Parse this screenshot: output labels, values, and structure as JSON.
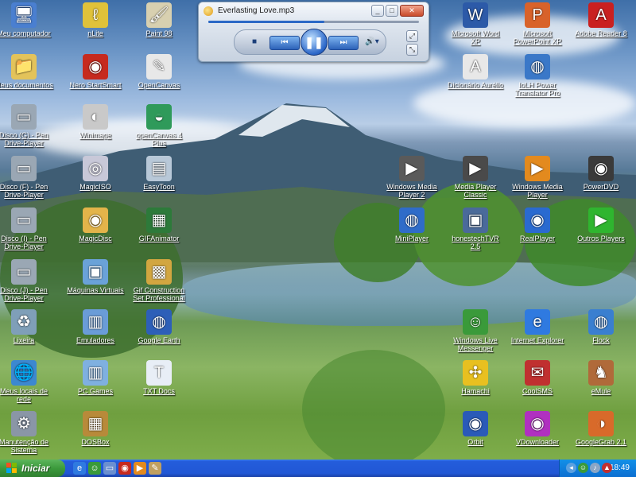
{
  "desktop_icons": [
    {
      "label": "Meu computador",
      "icon": "computer-icon",
      "color": "#4a7fd0",
      "glyph": "🖥"
    },
    {
      "label": "nLite",
      "icon": "nlite-icon",
      "color": "#e0c23a",
      "glyph": "ℓ"
    },
    {
      "label": "Paint 98",
      "icon": "paint-icon",
      "color": "#d8d0b0",
      "glyph": "🖌"
    },
    {
      "label": "Meus documentos",
      "icon": "folder-icon",
      "color": "#e3c35a",
      "glyph": "📁"
    },
    {
      "label": "Nero StartSmart",
      "icon": "nero-icon",
      "color": "#c62a1e",
      "glyph": "◉"
    },
    {
      "label": "OpenCanvas",
      "icon": "opencanvas-icon",
      "color": "#e8e8e8",
      "glyph": "✎"
    },
    {
      "label": "Disco (G) - Pen Drive-Player",
      "icon": "usb-drive-icon",
      "color": "#9aa7b4",
      "glyph": "▭"
    },
    {
      "label": "Winimage",
      "icon": "winimage-icon",
      "color": "#c9c9c9",
      "glyph": "◐"
    },
    {
      "label": "openCanvas 4 Plus",
      "icon": "opencanvas-plus-icon",
      "color": "#2f9a5a",
      "glyph": "◒"
    },
    {
      "label": "Disco (F) - Pen Drive-Player",
      "icon": "usb-drive-icon",
      "color": "#9aa7b4",
      "glyph": "▭"
    },
    {
      "label": "MagicISO",
      "icon": "magiciso-icon",
      "color": "#c8c8d8",
      "glyph": "◎"
    },
    {
      "label": "EasyToon",
      "icon": "easytoon-icon",
      "color": "#b8c8d8",
      "glyph": "▤"
    },
    {
      "label": "Disco (I) - Pen Drive-Player",
      "icon": "usb-drive-icon",
      "color": "#9aa7b4",
      "glyph": "▭"
    },
    {
      "label": "MagicDisc",
      "icon": "magicdisc-icon",
      "color": "#e3b44a",
      "glyph": "◉"
    },
    {
      "label": "GIFAnimator",
      "icon": "gifanimator-icon",
      "color": "#2d7a3a",
      "glyph": "▦"
    },
    {
      "label": "Disco (J) - Pen Drive-Player",
      "icon": "usb-drive-icon",
      "color": "#9aa7b4",
      "glyph": "▭"
    },
    {
      "label": "Máquinas Virtuais",
      "icon": "virtual-machine-icon",
      "color": "#6aa2d8",
      "glyph": "▣"
    },
    {
      "label": "Gif Construction Set Professional",
      "icon": "gif-construction-icon",
      "color": "#d2a640",
      "glyph": "▩"
    },
    {
      "label": "Lixeira",
      "icon": "recycle-bin-icon",
      "color": "#7f9fb8",
      "glyph": "♻"
    },
    {
      "label": "Emuladores",
      "icon": "folder-icon",
      "color": "#6a9cd8",
      "glyph": "▥"
    },
    {
      "label": "Google Earth",
      "icon": "google-earth-icon",
      "color": "#2d5fb8",
      "glyph": "◍"
    },
    {
      "label": "Meus locais de rede",
      "icon": "network-icon",
      "color": "#3c88d0",
      "glyph": "🌐"
    },
    {
      "label": "PC Games",
      "icon": "folder-icon",
      "color": "#7fb0e0",
      "glyph": "▥"
    },
    {
      "label": "TXT Docs",
      "icon": "text-document-icon",
      "color": "#e8eef6",
      "glyph": "T"
    },
    {
      "label": "Manutenção de Sistema",
      "icon": "gear-icon",
      "color": "#8a96a6",
      "glyph": "⚙"
    },
    {
      "label": "DOSBox",
      "icon": "dosbox-icon",
      "color": "#b88a3a",
      "glyph": "▦"
    },
    {
      "label": "Microsoft Word XP",
      "icon": "word-icon",
      "color": "#2c5aa8",
      "glyph": "W"
    },
    {
      "label": "Microsoft PowerPoint XP",
      "icon": "powerpoint-icon",
      "color": "#d8622a",
      "glyph": "P"
    },
    {
      "label": "Adobe Reader 8",
      "icon": "adobe-reader-icon",
      "color": "#c92020",
      "glyph": "A"
    },
    {
      "label": "Dicionário Aurélio",
      "icon": "dictionary-icon",
      "color": "#e8e8e8",
      "glyph": "A"
    },
    {
      "label": "IoLH Power Translator Pro",
      "icon": "globe-icon",
      "color": "#3a78c8",
      "glyph": "◍"
    },
    {
      "label": "Windows Media Player 2",
      "icon": "media-player-icon",
      "color": "#5a5a5a",
      "glyph": "▶"
    },
    {
      "label": "Media Player Classic",
      "icon": "media-player-classic-icon",
      "color": "#4a4a4a",
      "glyph": "▶"
    },
    {
      "label": "Windows Media Player",
      "icon": "windows-media-player-icon",
      "color": "#e38a1e",
      "glyph": "▶"
    },
    {
      "label": "PowerDVD",
      "icon": "powerdvd-icon",
      "color": "#3a3a3a",
      "glyph": "◉"
    },
    {
      "label": "MiniPlayer",
      "icon": "miniplayer-icon",
      "color": "#2f6cc9",
      "glyph": "◍"
    },
    {
      "label": "honestechTVR 2.5",
      "icon": "tv-icon",
      "color": "#4a6a9a",
      "glyph": "▣"
    },
    {
      "label": "RealPlayer",
      "icon": "realplayer-icon",
      "color": "#2a6ad0",
      "glyph": "◉"
    },
    {
      "label": "Outros Players",
      "icon": "play-arrow-icon",
      "color": "#2fb52f",
      "glyph": "▶"
    },
    {
      "label": "Windows Live Messenger",
      "icon": "messenger-icon",
      "color": "#3a9a3a",
      "glyph": "☺"
    },
    {
      "label": "Internet Explorer",
      "icon": "internet-explorer-icon",
      "color": "#2f7ae0",
      "glyph": "e"
    },
    {
      "label": "Flock",
      "icon": "flock-icon",
      "color": "#3a7fd0",
      "glyph": "◍"
    },
    {
      "label": "Hamachi",
      "icon": "hamachi-icon",
      "color": "#e8c020",
      "glyph": "✣"
    },
    {
      "label": "CoolSMS",
      "icon": "coolsms-icon",
      "color": "#c03030",
      "glyph": "✉"
    },
    {
      "label": "eMule",
      "icon": "emule-icon",
      "color": "#b06a3a",
      "glyph": "♞"
    },
    {
      "label": "Orbit",
      "icon": "orbit-icon",
      "color": "#2a5ab8",
      "glyph": "◉"
    },
    {
      "label": "VDownloader",
      "icon": "vdownloader-icon",
      "color": "#b030c0",
      "glyph": "◉"
    },
    {
      "label": "GoogleGrab 2.1",
      "icon": "googlegrab-icon",
      "color": "#d86a2a",
      "glyph": "◑"
    }
  ],
  "player": {
    "title": "Everlasting Love.mp3",
    "progress_fraction": 0.55,
    "stop_glyph": "■",
    "prev_glyph": "⏮",
    "play_pause_glyph": "❚❚",
    "next_glyph": "⏭",
    "volume_glyph": "🔊▾",
    "minimize_glyph": "_",
    "maximize_glyph": "□",
    "close_glyph": "✕",
    "restore_glyph": "⤢",
    "compact_glyph": "⤡"
  },
  "taskbar": {
    "start_label": "Iniciar",
    "clock": "18:49",
    "quicklaunch": [
      {
        "icon": "internet-explorer-icon",
        "color": "#2f7ae0",
        "glyph": "e"
      },
      {
        "icon": "messenger-icon",
        "color": "#3a9a3a",
        "glyph": "☺"
      },
      {
        "icon": "desktop-icon",
        "color": "#6a8fd0",
        "glyph": "▭"
      },
      {
        "icon": "nero-icon",
        "color": "#c62a1e",
        "glyph": "◉"
      },
      {
        "icon": "windows-media-player-icon",
        "color": "#e38a1e",
        "glyph": "▶"
      },
      {
        "icon": "paint-icon",
        "color": "#c0a060",
        "glyph": "✎"
      }
    ],
    "tray": [
      {
        "icon": "network-icon",
        "color": "#5aa0e0",
        "glyph": "◂"
      },
      {
        "icon": "messenger-icon",
        "color": "#3a9a3a",
        "glyph": "☺"
      },
      {
        "icon": "volume-icon",
        "color": "#8aa6c6",
        "glyph": "♪"
      },
      {
        "icon": "shield-icon",
        "color": "#c03030",
        "glyph": "▲"
      }
    ]
  }
}
